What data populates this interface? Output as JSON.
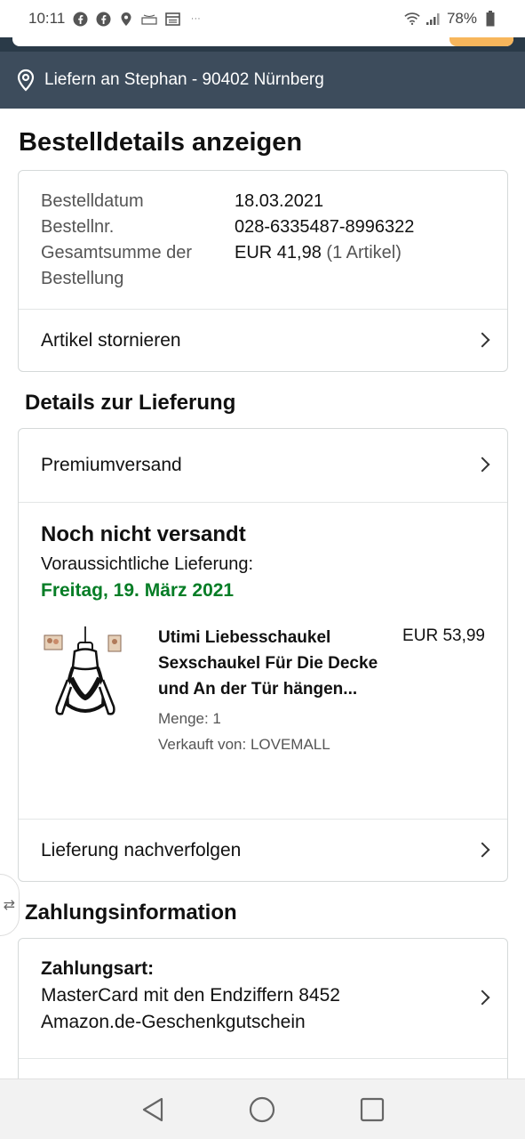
{
  "status_bar": {
    "time": "10:11",
    "battery": "78%",
    "icons": [
      "facebook-icon",
      "facebook-icon",
      "location-icon",
      "amazon-icon",
      "calendar-icon",
      "more-icon"
    ]
  },
  "delivery_bar": {
    "text": "Liefern an Stephan - 90402 Nürnberg"
  },
  "page": {
    "title": "Bestelldetails anzeigen"
  },
  "order_info": {
    "rows": [
      {
        "label": "Bestelldatum",
        "value": "18.03.2021"
      },
      {
        "label": "Bestellnr.",
        "value": "028-6335487-8996322"
      },
      {
        "label": "Gesamtsumme der Bestellung",
        "value": "EUR 41,98",
        "extra": "(1 Artikel)"
      }
    ],
    "cancel_label": "Artikel stornieren"
  },
  "delivery": {
    "section_title": "Details zur Lieferung",
    "shipping_type": "Premiumversand",
    "status": "Noch nicht versandt",
    "estimate_label": "Voraussichtliche Lieferung:",
    "estimate_date": "Freitag, 19. März 2021",
    "product": {
      "title": "Utimi Liebesschaukel Sexschaukel Für Die Decke und An der Tür hängen...",
      "quantity": "Menge: 1",
      "seller": "Verkauft von: LOVEMALL",
      "price": "EUR 53,99"
    },
    "track_label": "Lieferung nachverfolgen"
  },
  "payment": {
    "section_title": "Zahlungsinformation",
    "heading": "Zahlungsart:",
    "method_1": "MasterCard mit den Endziffern 8452",
    "method_2": "Amazon.de-Geschenkgutschein"
  },
  "colors": {
    "header_dark": "#3d4c5c",
    "green": "#067d26",
    "search_button": "#f7b65c"
  }
}
